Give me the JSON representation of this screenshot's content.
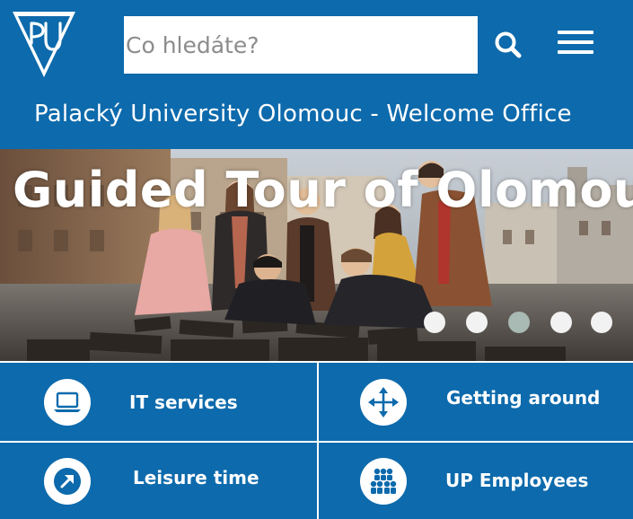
{
  "colors": {
    "brand": "#0d6aac",
    "white": "#ffffff",
    "inactive_dot": "#f2f2f2",
    "active_dot": "#a9b9b3"
  },
  "header": {
    "logo_icon": "up-shield-logo-icon",
    "search": {
      "placeholder": "Co hledáte?",
      "value": ""
    },
    "search_icon": "search-icon",
    "menu_icon": "hamburger-menu-icon",
    "title": "Palacký University Olomouc - Welcome Office"
  },
  "hero": {
    "title": "Guided Tour of Olomouc",
    "image": "students-around-city-model-photo",
    "slide_count": 5,
    "active_slide": 3
  },
  "tiles": [
    {
      "label": "IT services",
      "icon": "laptop-icon"
    },
    {
      "label": "Getting around",
      "icon": "move-arrows-icon"
    },
    {
      "label": "Leisure time",
      "icon": "arrow-out-icon"
    },
    {
      "label": "UP Employees",
      "icon": "people-group-icon"
    }
  ]
}
